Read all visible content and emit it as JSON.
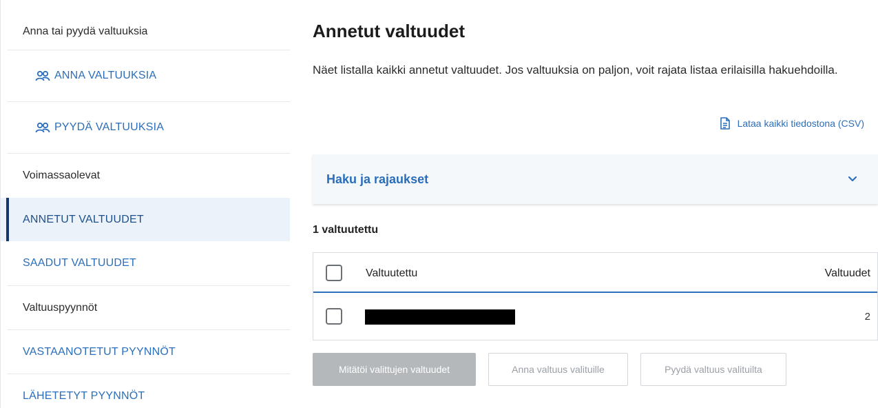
{
  "sidebar": {
    "section_give": "Anna tai pyydä valtuuksia",
    "give_label": "ANNA VALTUUKSIA",
    "request_label": "PYYDÄ VALTUUKSIA",
    "section_valid": "Voimassaolevat",
    "given_label": "ANNETUT VALTUUDET",
    "received_label": "SAADUT VALTUUDET",
    "section_requests": "Valtuuspyynnöt",
    "incoming_label": "VASTAANOTETUT PYYNNÖT",
    "sent_label": "LÄHETETYT PYYNNÖT"
  },
  "main": {
    "title": "Annetut valtuudet",
    "description": "Näet listalla kaikki annetut valtuudet. Jos valtuuksia on paljon, voit rajata listaa erilaisilla hakuehdoilla.",
    "csv_label": "Lataa kaikki tiedostona (CSV)",
    "filter_label": "Haku ja rajaukset",
    "count_label": "1 valtuutettu"
  },
  "table": {
    "columns": [
      "Valtuutettu",
      "Valtuudet"
    ],
    "rows": [
      {
        "name": "",
        "count": "2"
      }
    ]
  },
  "actions": {
    "revoke_label": "Mitätöi valittujen valtuudet",
    "give_selected_label": "Anna valtuus valituille",
    "request_selected_label": "Pyydä valtuus valituilta"
  },
  "icons": {
    "people": "people-icon",
    "document": "document-icon",
    "chevron": "chevron-down-icon"
  },
  "colors": {
    "link": "#2a6ebb",
    "active_bar": "#13366b",
    "active_bg": "#ecf2f9",
    "disabled_button": "#b5b8bb"
  }
}
